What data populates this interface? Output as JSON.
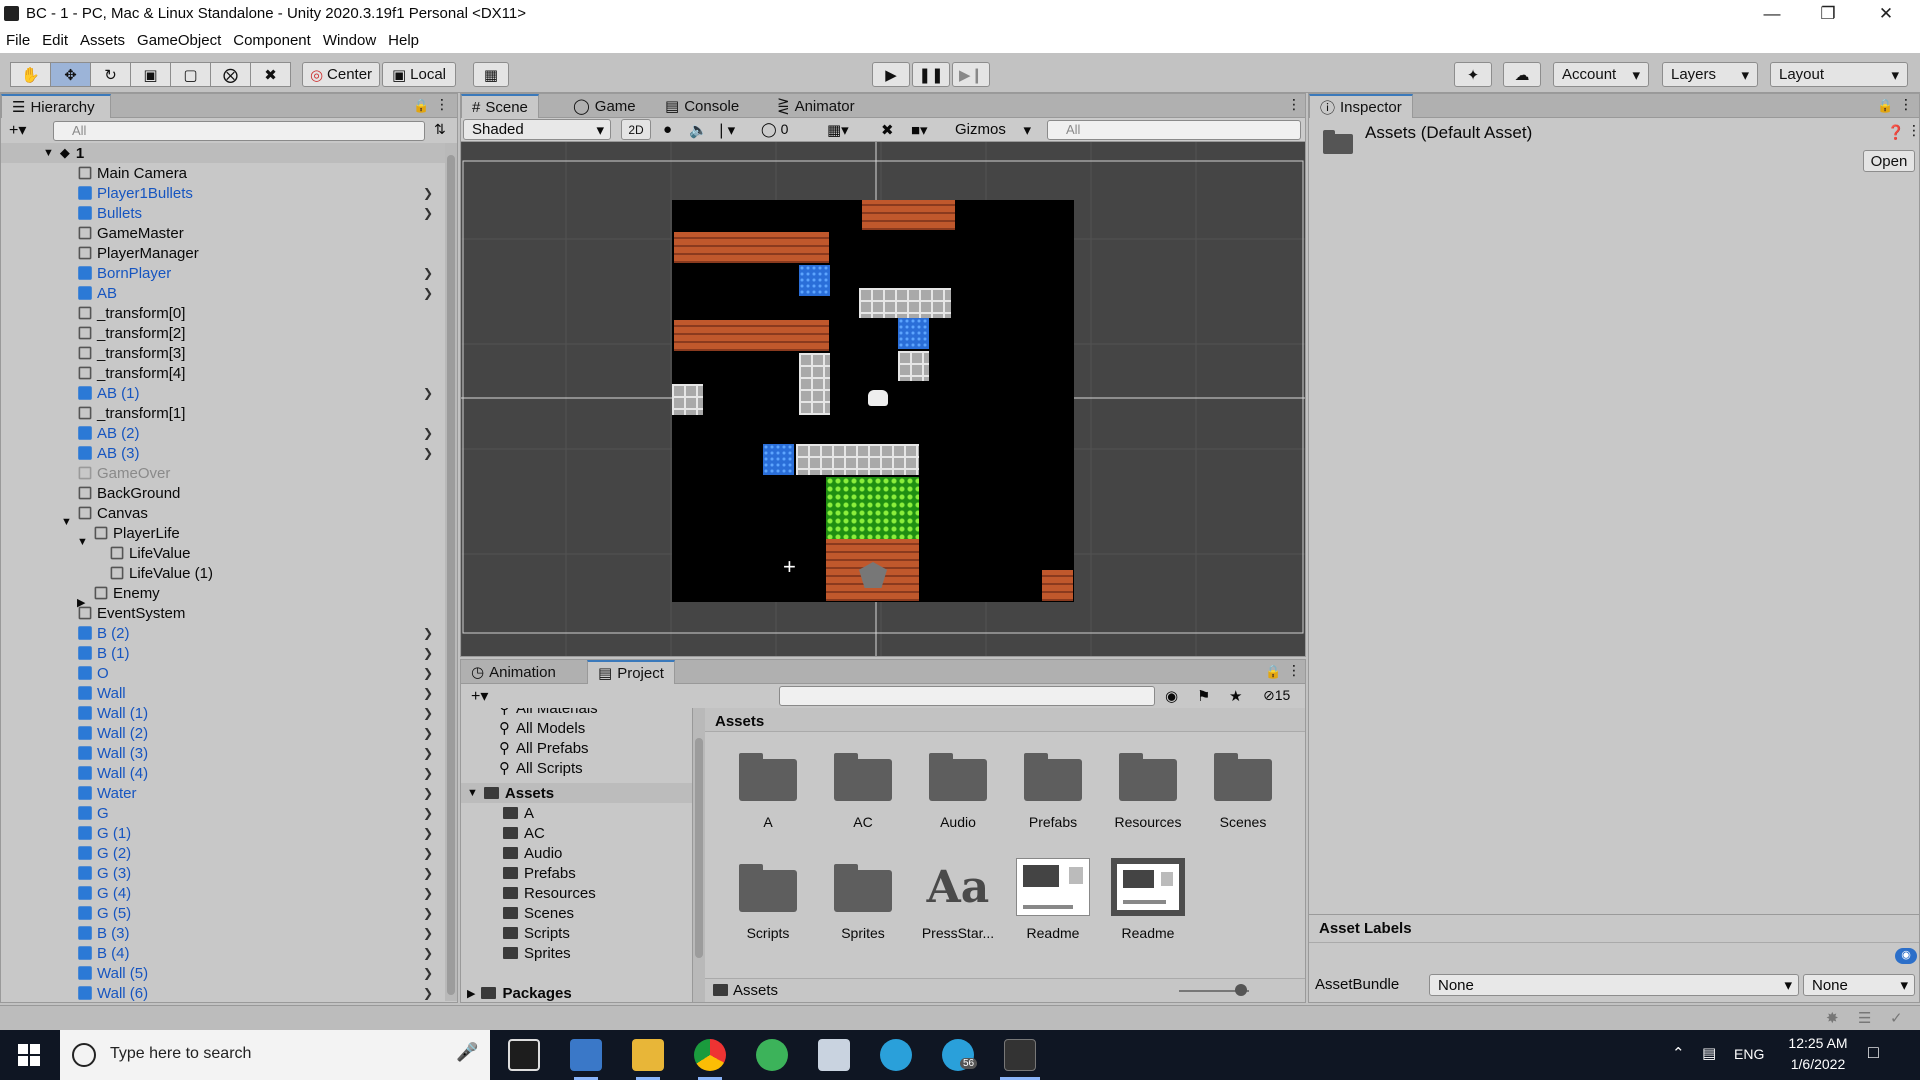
{
  "window": {
    "title": "BC - 1 - PC, Mac & Linux Standalone - Unity 2020.3.19f1 Personal <DX11>"
  },
  "menu": [
    "File",
    "Edit",
    "Assets",
    "GameObject",
    "Component",
    "Window",
    "Help"
  ],
  "toolbar": {
    "center_label": "Center",
    "local_label": "Local",
    "account_label": "Account",
    "layers_label": "Layers",
    "layout_label": "Layout"
  },
  "hierarchy": {
    "tab_label": "Hierarchy",
    "search_placeholder": "All",
    "scene_name": "1",
    "items": [
      {
        "name": "Main Camera",
        "type": "go",
        "indent": 1,
        "arrow": false
      },
      {
        "name": "Player1Bullets",
        "type": "prefab",
        "indent": 1,
        "arrow": true
      },
      {
        "name": "Bullets",
        "type": "prefab",
        "indent": 1,
        "arrow": true
      },
      {
        "name": "GameMaster",
        "type": "go",
        "indent": 1,
        "arrow": false
      },
      {
        "name": "PlayerManager",
        "type": "go",
        "indent": 1,
        "arrow": false
      },
      {
        "name": "BornPlayer",
        "type": "prefab",
        "indent": 1,
        "arrow": true
      },
      {
        "name": "AB",
        "type": "prefab",
        "indent": 1,
        "arrow": true
      },
      {
        "name": "_transform[0]",
        "type": "go",
        "indent": 1,
        "arrow": false
      },
      {
        "name": "_transform[2]",
        "type": "go",
        "indent": 1,
        "arrow": false
      },
      {
        "name": "_transform[3]",
        "type": "go",
        "indent": 1,
        "arrow": false
      },
      {
        "name": "_transform[4]",
        "type": "go",
        "indent": 1,
        "arrow": false
      },
      {
        "name": "AB (1)",
        "type": "prefab",
        "indent": 1,
        "arrow": true
      },
      {
        "name": "_transform[1]",
        "type": "go",
        "indent": 1,
        "arrow": false
      },
      {
        "name": "AB (2)",
        "type": "prefab",
        "indent": 1,
        "arrow": true
      },
      {
        "name": "AB (3)",
        "type": "prefab",
        "indent": 1,
        "arrow": true
      },
      {
        "name": "GameOver",
        "type": "dim",
        "indent": 1,
        "arrow": false
      },
      {
        "name": "BackGround",
        "type": "go",
        "indent": 1,
        "arrow": false
      },
      {
        "name": "Canvas",
        "type": "go",
        "indent": 1,
        "arrow": false,
        "fold": "open"
      },
      {
        "name": "PlayerLife",
        "type": "go",
        "indent": 2,
        "arrow": false,
        "fold": "open"
      },
      {
        "name": "LifeValue",
        "type": "go",
        "indent": 3,
        "arrow": false
      },
      {
        "name": "LifeValue (1)",
        "type": "go",
        "indent": 3,
        "arrow": false
      },
      {
        "name": "Enemy",
        "type": "go",
        "indent": 2,
        "arrow": false,
        "fold": "closed"
      },
      {
        "name": "EventSystem",
        "type": "go",
        "indent": 1,
        "arrow": false
      },
      {
        "name": "B (2)",
        "type": "prefab",
        "indent": 1,
        "arrow": true
      },
      {
        "name": "B (1)",
        "type": "prefab",
        "indent": 1,
        "arrow": true
      },
      {
        "name": "O",
        "type": "prefab",
        "indent": 1,
        "arrow": true
      },
      {
        "name": "Wall",
        "type": "prefab",
        "indent": 1,
        "arrow": true
      },
      {
        "name": "Wall (1)",
        "type": "prefab",
        "indent": 1,
        "arrow": true
      },
      {
        "name": "Wall (2)",
        "type": "prefab",
        "indent": 1,
        "arrow": true
      },
      {
        "name": "Wall (3)",
        "type": "prefab",
        "indent": 1,
        "arrow": true
      },
      {
        "name": "Wall (4)",
        "type": "prefab",
        "indent": 1,
        "arrow": true
      },
      {
        "name": "Water",
        "type": "prefab",
        "indent": 1,
        "arrow": true
      },
      {
        "name": "G",
        "type": "prefab",
        "indent": 1,
        "arrow": true
      },
      {
        "name": "G (1)",
        "type": "prefab",
        "indent": 1,
        "arrow": true
      },
      {
        "name": "G (2)",
        "type": "prefab",
        "indent": 1,
        "arrow": true
      },
      {
        "name": "G (3)",
        "type": "prefab",
        "indent": 1,
        "arrow": true
      },
      {
        "name": "G (4)",
        "type": "prefab",
        "indent": 1,
        "arrow": true
      },
      {
        "name": "G (5)",
        "type": "prefab",
        "indent": 1,
        "arrow": true
      },
      {
        "name": "B (3)",
        "type": "prefab",
        "indent": 1,
        "arrow": true
      },
      {
        "name": "B (4)",
        "type": "prefab",
        "indent": 1,
        "arrow": true
      },
      {
        "name": "Wall (5)",
        "type": "prefab",
        "indent": 1,
        "arrow": true
      },
      {
        "name": "Wall (6)",
        "type": "prefab",
        "indent": 1,
        "arrow": true
      }
    ]
  },
  "scene_tabs": [
    "Scene",
    "Game",
    "Console",
    "Animator"
  ],
  "scene_bar": {
    "shading": "Shaded",
    "mode_2d": "2D",
    "hidden_count": "0",
    "gizmos": "Gizmos",
    "search_placeholder": "All"
  },
  "inspector": {
    "tab_label": "Inspector",
    "asset_title": "Assets (Default Asset)",
    "open_button": "Open",
    "labels_header": "Asset Labels",
    "assetbundle_label": "AssetBundle",
    "assetbundle_value": "None",
    "variant_value": "None"
  },
  "project": {
    "tabs": [
      "Animation",
      "Project"
    ],
    "hidden_count": "15",
    "favorites": [
      "All Materials",
      "All Models",
      "All Prefabs",
      "All Scripts"
    ],
    "assets_root": "Assets",
    "folders": [
      "A",
      "AC",
      "Audio",
      "Prefabs",
      "Resources",
      "Scenes",
      "Scripts",
      "Sprites"
    ],
    "packages": "Packages",
    "grid_header": "Assets",
    "grid_items": [
      {
        "label": "A",
        "kind": "folder"
      },
      {
        "label": "AC",
        "kind": "folder"
      },
      {
        "label": "Audio",
        "kind": "folder"
      },
      {
        "label": "Prefabs",
        "kind": "folder"
      },
      {
        "label": "Resources",
        "kind": "folder"
      },
      {
        "label": "Scenes",
        "kind": "folder"
      },
      {
        "label": "Scripts",
        "kind": "folder"
      },
      {
        "label": "Sprites",
        "kind": "folder"
      },
      {
        "label": "PressStar...",
        "kind": "font"
      },
      {
        "label": "Readme",
        "kind": "thumb"
      },
      {
        "label": "Readme",
        "kind": "thumb-selected"
      }
    ],
    "footer_path": "Assets"
  },
  "taskbar": {
    "search_placeholder": "Type here to search",
    "lang": "ENG",
    "time": "12:25 AM",
    "date": "1/6/2022",
    "telegram_badge": "56"
  }
}
